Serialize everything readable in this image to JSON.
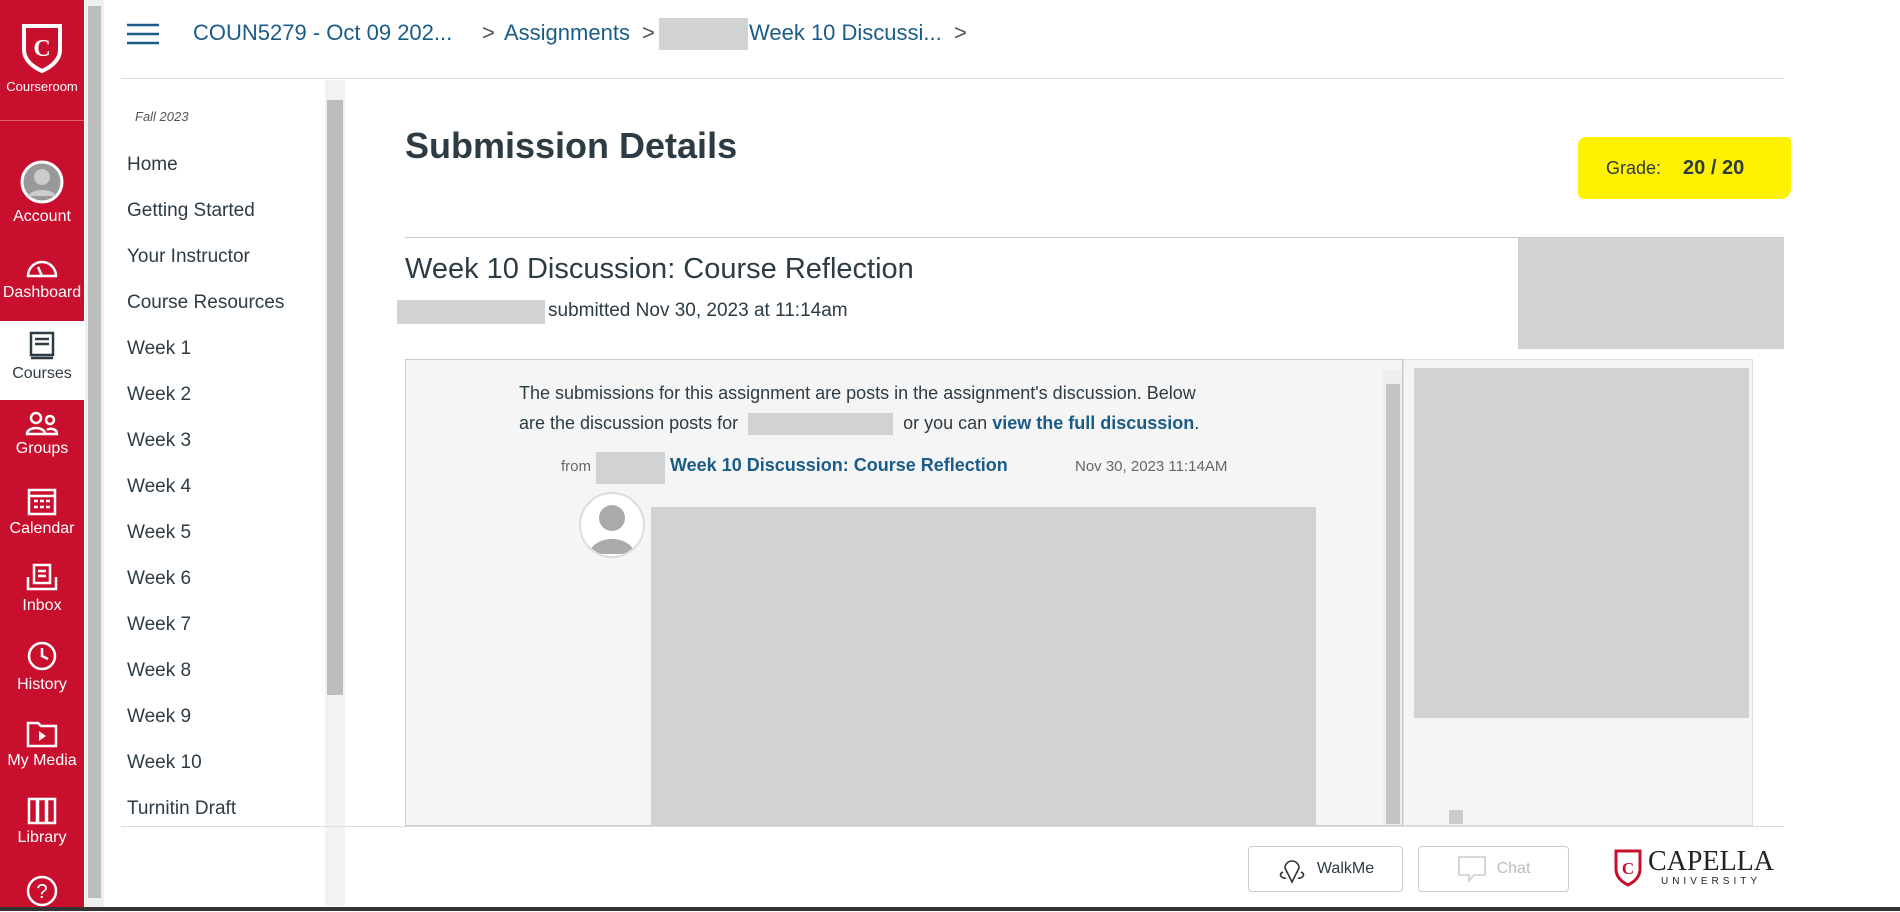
{
  "global_nav": {
    "items": [
      {
        "label": "Courseroom",
        "icon": "capella-shield-icon"
      },
      {
        "label": "Account",
        "icon": "avatar-icon"
      },
      {
        "label": "Dashboard",
        "icon": "speedometer-icon"
      },
      {
        "label": "Courses",
        "icon": "book-icon",
        "active": true
      },
      {
        "label": "Groups",
        "icon": "people-icon"
      },
      {
        "label": "Calendar",
        "icon": "calendar-icon"
      },
      {
        "label": "Inbox",
        "icon": "inbox-icon"
      },
      {
        "label": "History",
        "icon": "clock-icon"
      },
      {
        "label": "My Media",
        "icon": "media-icon"
      },
      {
        "label": "Library",
        "icon": "library-icon"
      },
      {
        "label": "",
        "icon": "help-icon"
      }
    ],
    "color": "#c8102e"
  },
  "breadcrumb": {
    "course": "COUN5279 - Oct 09 202...",
    "assignments": "Assignments",
    "assignment": "Week 10 Discussi...",
    "separator": ">"
  },
  "course_nav": {
    "term": "Fall 2023",
    "items": [
      "Home",
      "Getting Started",
      "Your Instructor",
      "Course Resources",
      "Week 1",
      "Week 2",
      "Week 3",
      "Week 4",
      "Week 5",
      "Week 6",
      "Week 7",
      "Week 8",
      "Week 9",
      "Week 10",
      "Turnitin Draft"
    ]
  },
  "main": {
    "title": "Submission Details",
    "grade_label": "Grade:",
    "grade_value": "20 / 20",
    "highlight_color": "#fff200",
    "assignment_title": "Week 10 Discussion: Course Reflection",
    "submitted_text": "submitted Nov 30, 2023 at 11:14am",
    "frame": {
      "text_1": "The submissions for this assignment are posts in the assignment's discussion. Below",
      "text_2a": "are the discussion posts for",
      "text_2b": "or you can",
      "link": "view the full discussion",
      "text_2c": ".",
      "from": "from",
      "post_link": "Week 10 Discussion: Course Reflection",
      "post_date": "Nov 30, 2023 11:14AM"
    }
  },
  "footer": {
    "walkme": "WalkMe",
    "chat": "Chat",
    "logo_main": "CAPELLA",
    "logo_sub": "UNIVERSITY"
  }
}
